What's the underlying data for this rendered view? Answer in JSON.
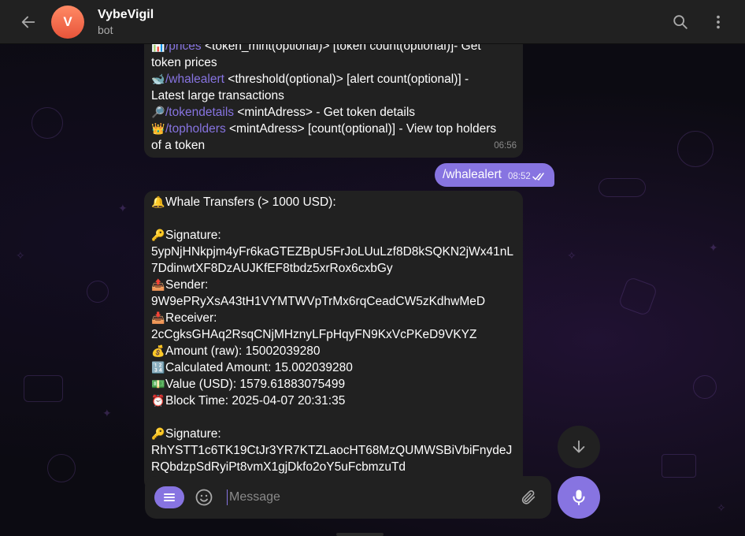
{
  "header": {
    "title": "VybeVigil",
    "subtitle": "bot",
    "avatar_letter": "V",
    "avatar_color": "#e8543a"
  },
  "colors": {
    "accent": "#8774e1",
    "bubble_bg": "#212121",
    "header_bg": "#212121"
  },
  "messages": {
    "help": {
      "lines": [
        {
          "emoji": "📊",
          "cmd": "/prices",
          "text": " <token_mint(optional)> [token count(optional)]- Get"
        },
        {
          "emoji": "",
          "cmd": "",
          "text": "token prices"
        },
        {
          "emoji": "🐋",
          "cmd": "/whalealert",
          "text": " <threshold(optional)> [alert count(optional)] -"
        },
        {
          "emoji": "",
          "cmd": "",
          "text": "Latest large transactions"
        },
        {
          "emoji": "🔎",
          "cmd": "/tokendetails",
          "text": " <mintAdress> - Get token details"
        },
        {
          "emoji": "👑",
          "cmd": "/topholders",
          "text": " <mintAdress> [count(optional)] - View top holders"
        },
        {
          "emoji": "",
          "cmd": "",
          "text": "of a token"
        }
      ],
      "time": "06:56"
    },
    "outgoing": {
      "text": "/whalealert",
      "time": "08:52"
    },
    "whale": {
      "lines": [
        {
          "emoji": "🔔",
          "text": "Whale Transfers (> 1000 USD):"
        },
        {
          "emoji": "",
          "text": ""
        },
        {
          "emoji": "🔑",
          "text": "Signature:"
        },
        {
          "emoji": "",
          "text": "5ypNjHNkpjm4yFr6kaGTEZBpU5FrJoLUuLzf8D8kSQKN2jWx41nL"
        },
        {
          "emoji": "",
          "text": "7DdinwtXF8DzAUJKfEF8tbdz5xrRox6cxbGy"
        },
        {
          "emoji": "📤",
          "text": "Sender:"
        },
        {
          "emoji": "",
          "text": "9W9ePRyXsA43tH1VYMTWVpTrMx6rqCeadCW5zKdhwMeD"
        },
        {
          "emoji": "📥",
          "text": "Receiver:"
        },
        {
          "emoji": "",
          "text": "2cCgksGHAq2RsqCNjMHznyLFpHqyFN9KxVcPKeD9VKYZ"
        },
        {
          "emoji": "💰",
          "text": "Amount (raw): 15002039280"
        },
        {
          "emoji": "🔢",
          "text": "Calculated Amount: 15.002039280"
        },
        {
          "emoji": "💵",
          "text": "Value (USD): 1579.61883075499"
        },
        {
          "emoji": "⏰",
          "text": "Block Time: 2025-04-07 20:31:35"
        },
        {
          "emoji": "",
          "text": ""
        },
        {
          "emoji": "🔑",
          "text": "Signature:"
        },
        {
          "emoji": "",
          "text": "RhYSTT1c6TK19CtJr3YR7KTZLaocHT68MzQUMWSBiVbiFnydeJ"
        },
        {
          "emoji": "",
          "text": "RQbdzpSdRyiPt8vmX1gjDkfo2oY5uFcbmzuTd"
        }
      ]
    }
  },
  "composer": {
    "placeholder": "Message"
  },
  "icons": {
    "back": "arrow-left-icon",
    "search": "search-icon",
    "more": "more-vertical-icon",
    "menu": "menu-icon",
    "emoji": "smile-icon",
    "attach": "paperclip-icon",
    "mic": "microphone-icon",
    "scroll": "arrow-down-icon"
  }
}
